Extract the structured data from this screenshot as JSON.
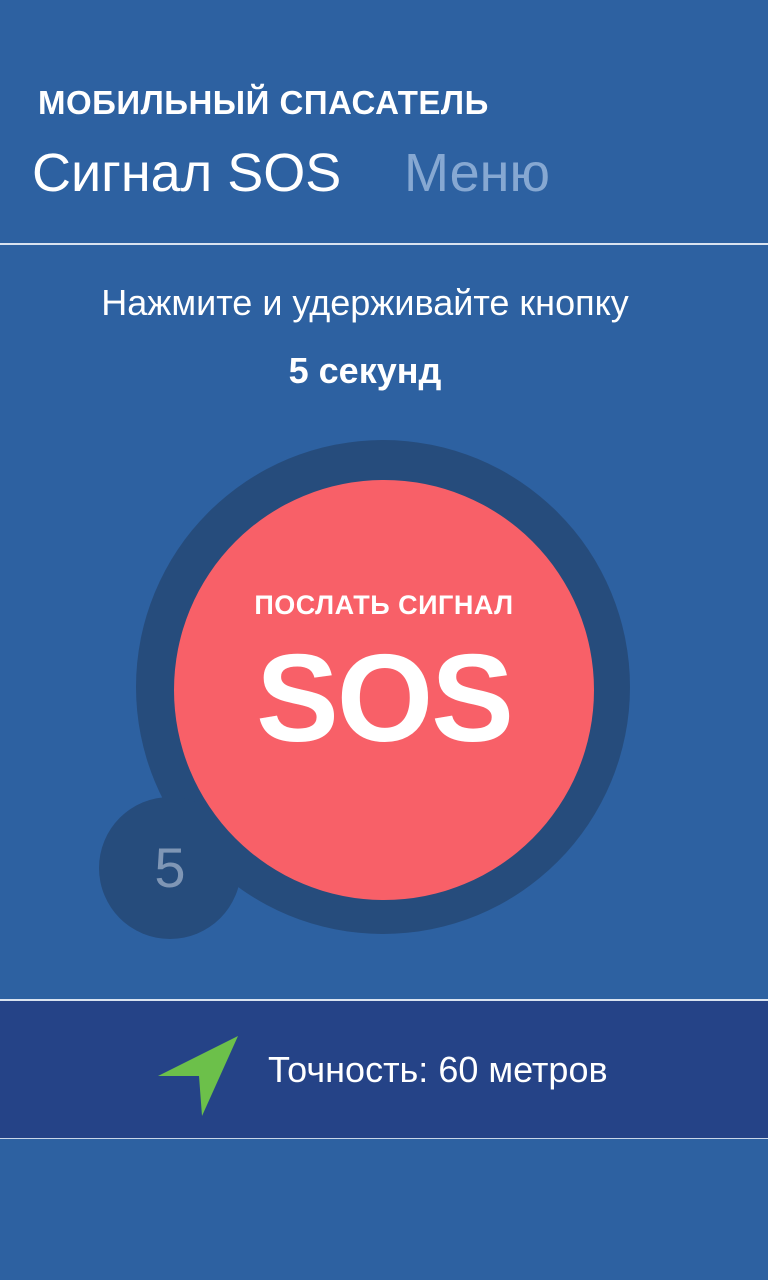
{
  "header": {
    "app_title": "МОБИЛЬНЫЙ СПАСАТЕЛЬ",
    "tabs": [
      {
        "label": "Сигнал SOS",
        "active": true
      },
      {
        "label": "Меню",
        "active": false
      }
    ]
  },
  "main": {
    "instruction": "Нажмите и удерживайте кнопку",
    "duration": "5 секунд",
    "sos_button": {
      "caption": "ПОСЛАТЬ СИГНАЛ",
      "label": "SOS"
    },
    "countdown": "5"
  },
  "status": {
    "icon": "navigation-arrow-icon",
    "accuracy_text": "Точность: 60 метров"
  },
  "colors": {
    "background": "#2d61a1",
    "ring": "#264c7c",
    "sos_red": "#f86068",
    "status_bar": "#254387",
    "inactive_tab": "#86a8d2",
    "nav_green": "#6cc04a"
  }
}
